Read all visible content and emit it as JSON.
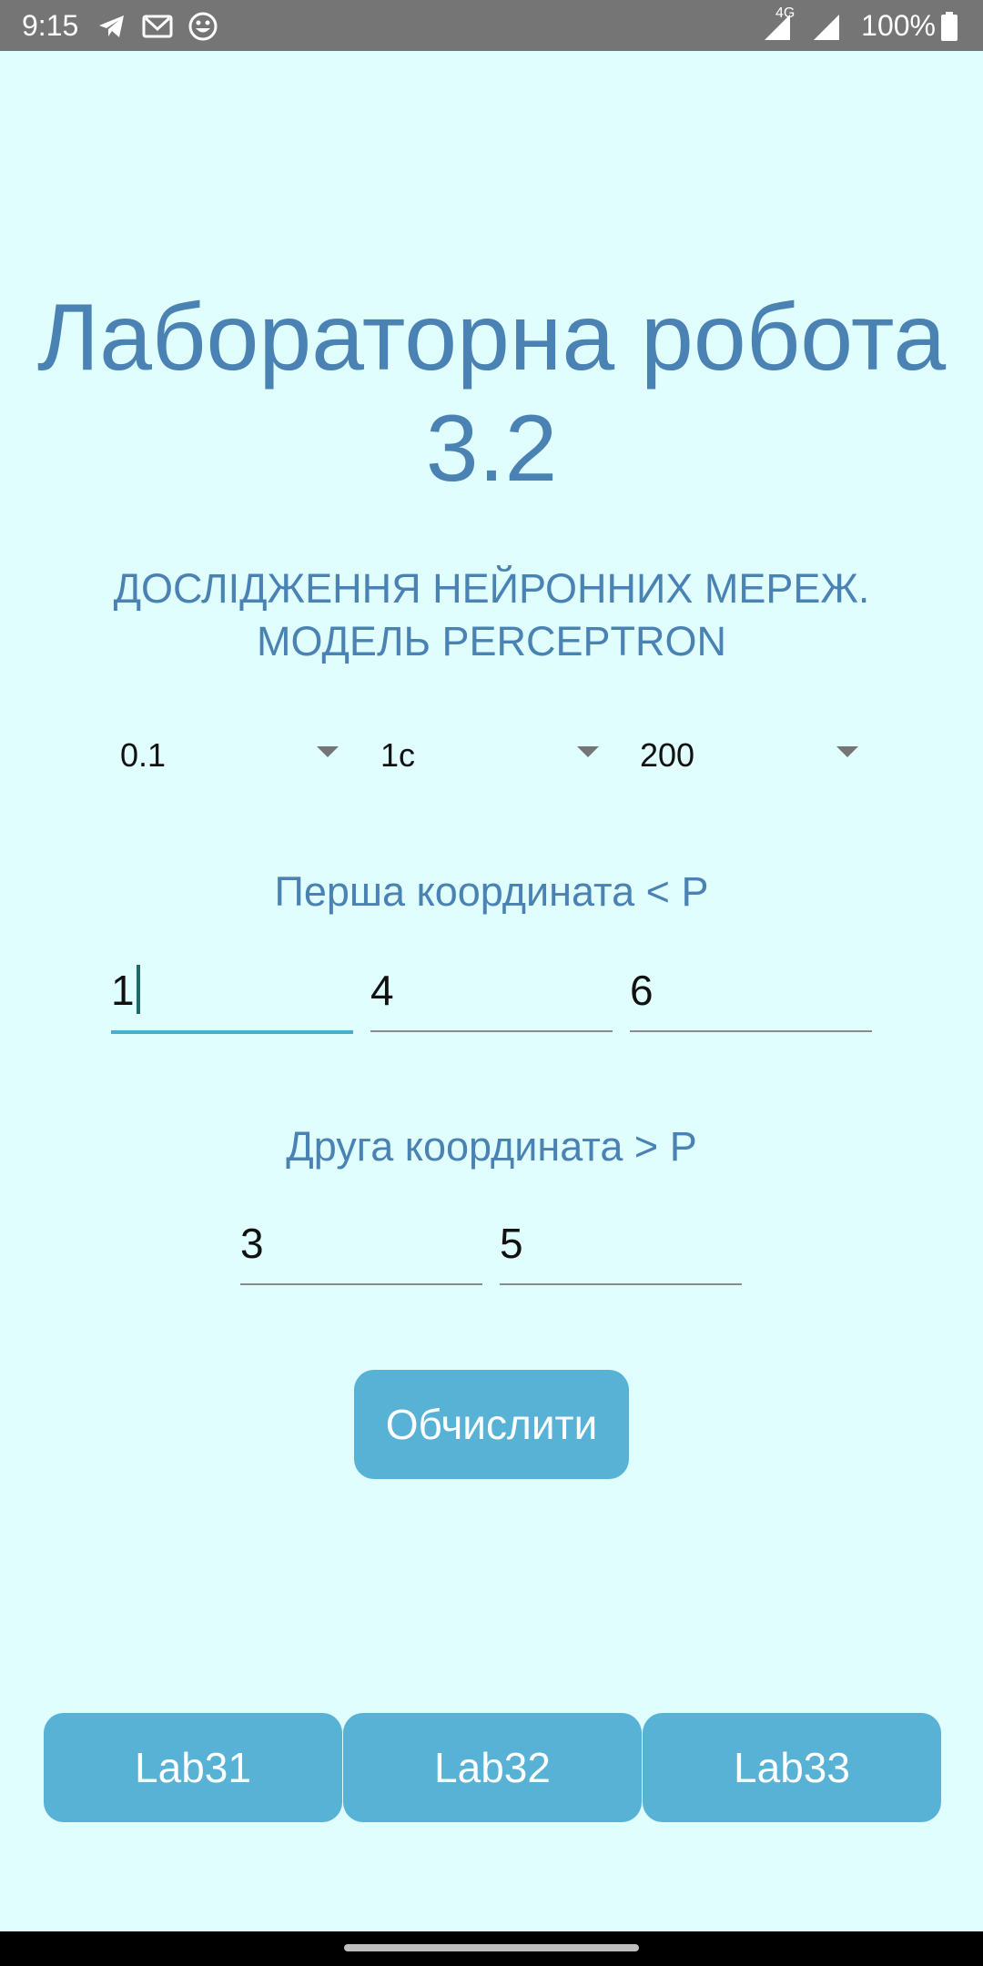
{
  "status_bar": {
    "time": "9:15",
    "network_label": "4G",
    "battery_percent": "100%",
    "notification_icons": [
      "telegram-icon",
      "gmail-icon",
      "emoji-icon"
    ]
  },
  "header": {
    "title": "Лабораторна робота 3.2",
    "subtitle_line1": "ДОСЛІДЖЕННЯ НЕЙРОННИХ МЕРЕЖ.",
    "subtitle_line2": "МОДЕЛЬ PERCEPTRON"
  },
  "dropdowns": [
    {
      "selected": "0.1"
    },
    {
      "selected": "1с"
    },
    {
      "selected": "200"
    }
  ],
  "first_coordinate": {
    "label": "Перша координата < P",
    "values": [
      "1",
      "4",
      "6"
    ]
  },
  "second_coordinate": {
    "label": "Друга координата > P",
    "values": [
      "3",
      "5"
    ]
  },
  "actions": {
    "calculate_label": "Обчислити"
  },
  "lab_tabs": [
    {
      "label": "Lab31"
    },
    {
      "label": "Lab32"
    },
    {
      "label": "Lab33"
    }
  ],
  "colors": {
    "background": "#e0fefe",
    "accent_text": "#4a82b4",
    "button": "#58b2d6",
    "focus_underline": "#4aaccf"
  }
}
